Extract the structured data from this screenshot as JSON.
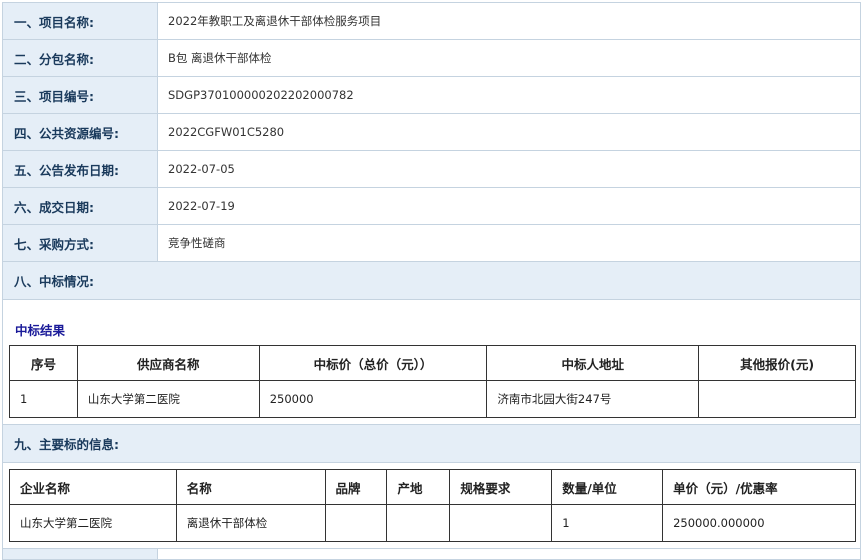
{
  "rows": [
    {
      "label": "一、项目名称:",
      "value": "2022年教职工及离退休干部体检服务项目"
    },
    {
      "label": "二、分包名称:",
      "value": "B包 离退休干部体检"
    },
    {
      "label": "三、项目编号:",
      "value": "SDGP370100000202202000782"
    },
    {
      "label": "四、公共资源编号:",
      "value": "2022CGFW01C5280"
    },
    {
      "label": "五、公告发布日期:",
      "value": "2022-07-05"
    },
    {
      "label": "六、成交日期:",
      "value": "2022-07-19"
    },
    {
      "label": "七、采购方式:",
      "value": "竞争性磋商"
    }
  ],
  "section8": {
    "title": "八、中标情况:",
    "subtitle": "中标结果",
    "headers": [
      "序号",
      "供应商名称",
      "中标价（总价（元））",
      "中标人地址",
      "其他报价(元)"
    ],
    "rows": [
      [
        "1",
        "山东大学第二医院",
        "250000",
        "济南市北园大街247号",
        ""
      ]
    ]
  },
  "section9": {
    "title": "九、主要标的信息:",
    "headers": [
      "企业名称",
      "名称",
      "品牌",
      "产地",
      "规格要求",
      "数量/单位",
      "单价（元）/优惠率"
    ],
    "rows": [
      [
        "山东大学第二医院",
        "离退休干部体检",
        "",
        "",
        "",
        "1",
        "250000.000000"
      ]
    ]
  }
}
